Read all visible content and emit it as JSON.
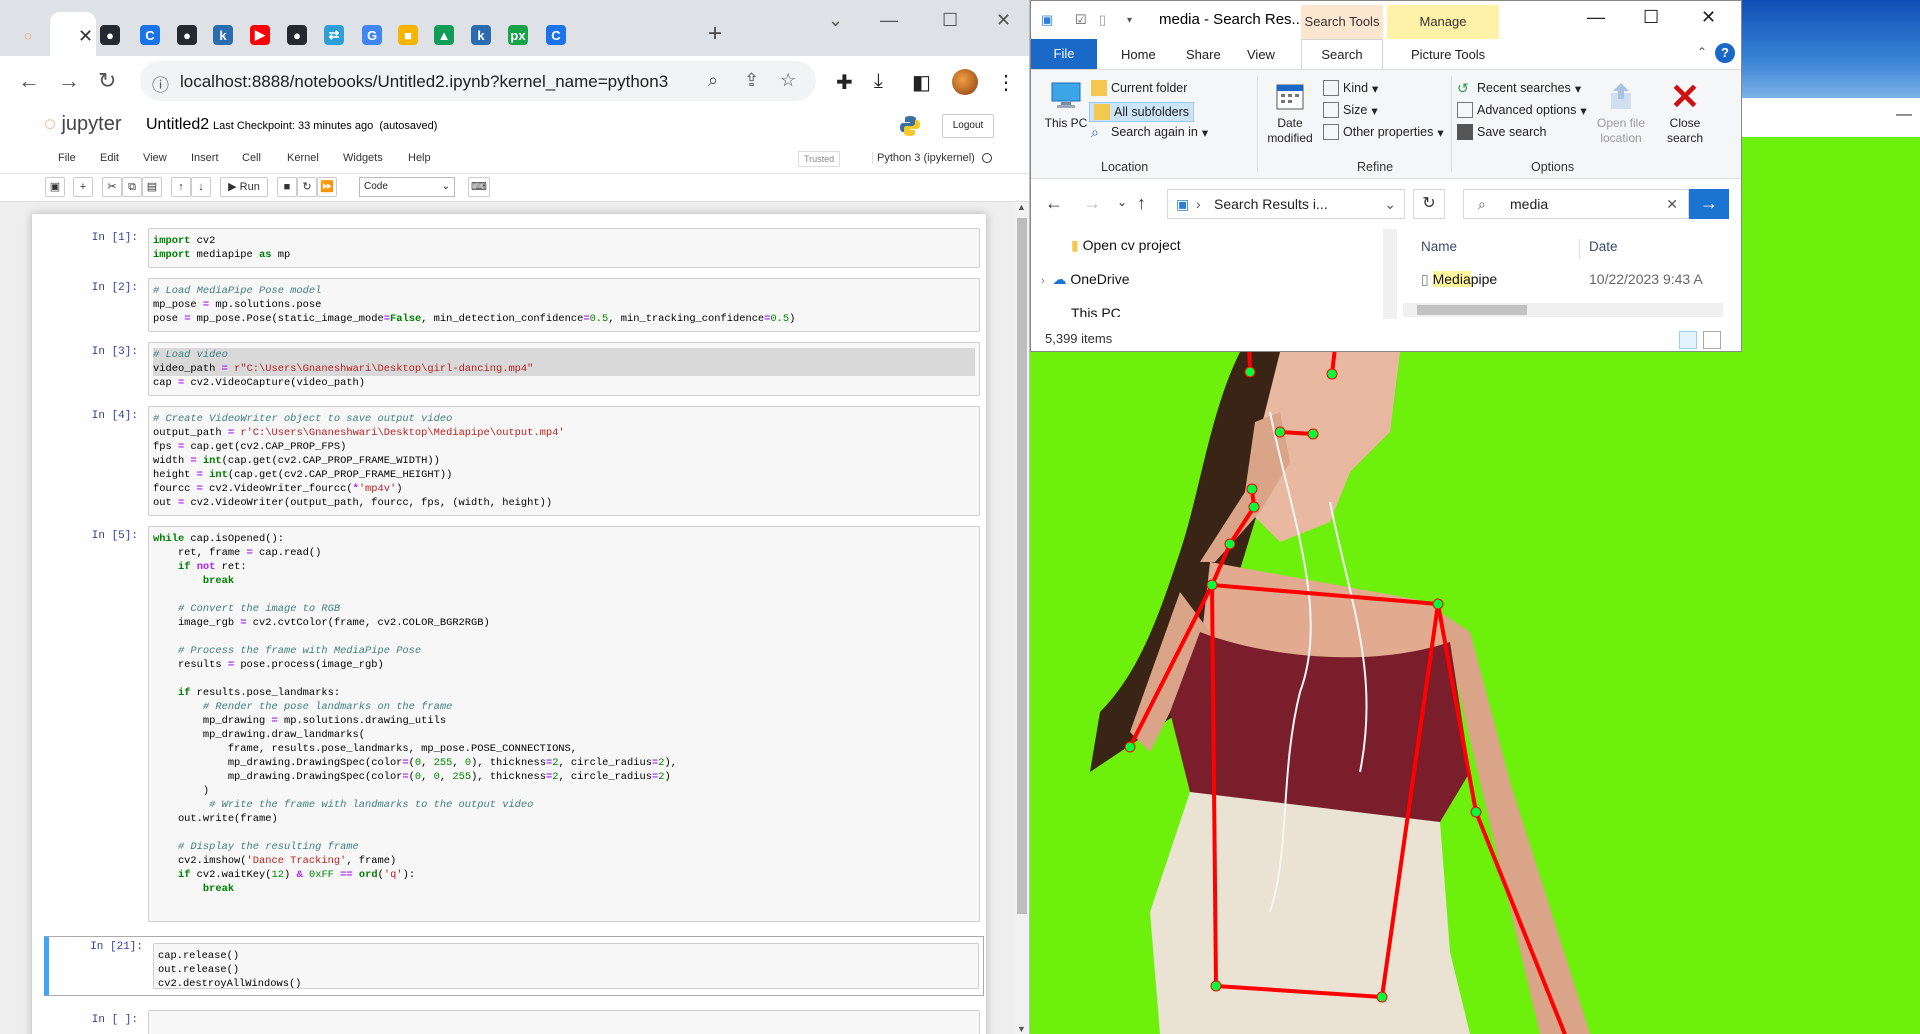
{
  "browser": {
    "url": "localhost:8888/notebooks/Untitled2.ipynb?kernel_name=python3",
    "tabs": [
      {
        "name": "tab-favicon-orange",
        "glyph": "◌",
        "color": "#f37726"
      },
      {
        "name": "tab-favicon-github",
        "glyph": "●",
        "color": "#24292f"
      },
      {
        "name": "tab-favicon-c",
        "glyph": "C",
        "color": "#1a73e8"
      },
      {
        "name": "tab-favicon-github-2",
        "glyph": "●",
        "color": "#24292f"
      },
      {
        "name": "tab-favicon-k",
        "glyph": "k",
        "color": "#2b6cb0"
      },
      {
        "name": "tab-favicon-youtube",
        "glyph": "▶",
        "color": "#ff0000"
      },
      {
        "name": "tab-favicon-github-3",
        "glyph": "●",
        "color": "#24292f"
      },
      {
        "name": "tab-favicon-arrows",
        "glyph": "⇄",
        "color": "#2e9fd6"
      },
      {
        "name": "tab-favicon-google",
        "glyph": "G",
        "color": "#4285f4"
      },
      {
        "name": "tab-favicon-yellow",
        "glyph": "■",
        "color": "#f4b400"
      },
      {
        "name": "tab-favicon-drive",
        "glyph": "▲",
        "color": "#0f9d58"
      },
      {
        "name": "tab-favicon-k-2",
        "glyph": "k",
        "color": "#2b6cb0"
      },
      {
        "name": "tab-favicon-px",
        "glyph": "px",
        "color": "#16a34a"
      },
      {
        "name": "tab-favicon-c-2",
        "glyph": "C",
        "color": "#1a73e8"
      }
    ]
  },
  "jupyter": {
    "logo_text": "jupyter",
    "notebook_title": "Untitled2",
    "checkpoint": "Last Checkpoint: 33 minutes ago",
    "autosaved": "(autosaved)",
    "logout": "Logout",
    "menu": [
      "File",
      "Edit",
      "View",
      "Insert",
      "Cell",
      "Kernel",
      "Widgets",
      "Help"
    ],
    "trusted": "Trusted",
    "kernel": "Python 3 (ipykernel)",
    "run_label": "Run",
    "cell_type": "Code",
    "cells": [
      {
        "prompt": "In [1]:",
        "code": "import cv2\nimport mediapipe as mp"
      },
      {
        "prompt": "In [2]:",
        "code": "# Load MediaPipe Pose model\nmp_pose = mp.solutions.pose\npose = mp_pose.Pose(static_image_mode=False, min_detection_confidence=0.5, min_tracking_confidence=0.5)"
      },
      {
        "prompt": "In [3]:",
        "code": "# Load video\nvideo_path = r\"C:\\Users\\Gnaneshwari\\Desktop\\girl-dancing.mp4\"\ncap = cv2.VideoCapture(video_path)"
      },
      {
        "prompt": "In [4]:",
        "code": "# Create VideoWriter object to save output video\noutput_path = r'C:\\Users\\Gnaneshwari\\Desktop\\Mediapipe\\output.mp4'\nfps = cap.get(cv2.CAP_PROP_FPS)\nwidth = int(cap.get(cv2.CAP_PROP_FRAME_WIDTH))\nheight = int(cap.get(cv2.CAP_PROP_FRAME_HEIGHT))\nfourcc = cv2.VideoWriter_fourcc(*'mp4v')\nout = cv2.VideoWriter(output_path, fourcc, fps, (width, height))"
      },
      {
        "prompt": "In [5]:",
        "code": "while cap.isOpened():\n    ret, frame = cap.read()\n    if not ret:\n        break\n\n    # Convert the image to RGB\n    image_rgb = cv2.cvtColor(frame, cv2.COLOR_BGR2RGB)\n\n    # Process the frame with MediaPipe Pose\n    results = pose.process(image_rgb)\n\n    if results.pose_landmarks:\n        # Render the pose landmarks on the frame\n        mp_drawing = mp.solutions.drawing_utils\n        mp_drawing.draw_landmarks(\n            frame, results.pose_landmarks, mp_pose.POSE_CONNECTIONS,\n            mp_drawing.DrawingSpec(color=(0, 255, 0), thickness=2, circle_radius=2),\n            mp_drawing.DrawingSpec(color=(0, 0, 255), thickness=2, circle_radius=2)\n        )\n         # Write the frame with landmarks to the output video\n    out.write(frame)\n\n    # Display the resulting frame\n    cv2.imshow('Dance Tracking', frame)\n    if cv2.waitKey(12) & 0xFF == ord('q'):\n        break"
      },
      {
        "prompt": "In [21]:",
        "code": "cap.release()\nout.release()\ncv2.destroyAllWindows()"
      },
      {
        "prompt": "In [ ]:",
        "code": ""
      }
    ]
  },
  "explorer": {
    "title": "media - Search Res...",
    "context_search_tools": "Search Tools",
    "context_manage": "Manage",
    "tabs": [
      "File",
      "Home",
      "Share",
      "View",
      "Search",
      "Picture Tools"
    ],
    "ribbon": {
      "this_pc": "This PC",
      "current_folder": "Current folder",
      "all_subfolders": "All subfolders",
      "search_again_in": "Search again in",
      "location_group": "Location",
      "date_modified": "Date modified",
      "kind": "Kind",
      "size": "Size",
      "other_properties": "Other properties",
      "refine_group": "Refine",
      "recent_searches": "Recent searches",
      "advanced_options": "Advanced options",
      "save_search": "Save search",
      "open_file_location": "Open file location",
      "close_search": "Close search",
      "options_group": "Options"
    },
    "path": "Search Results i...",
    "search_query": "media",
    "tree": [
      "Open cv project",
      "OneDrive",
      "This PC"
    ],
    "columns": [
      "Name",
      "Date"
    ],
    "file": {
      "name_match": "Media",
      "name_rest": "pipe",
      "date": "10/22/2023 9:43 A"
    },
    "item_count": "5,399 items"
  },
  "colors": {
    "skeleton": "#ff0000",
    "landmark": "#00ff3a",
    "chroma": "#6ef00d",
    "jupyter_accent": "#f37726"
  }
}
